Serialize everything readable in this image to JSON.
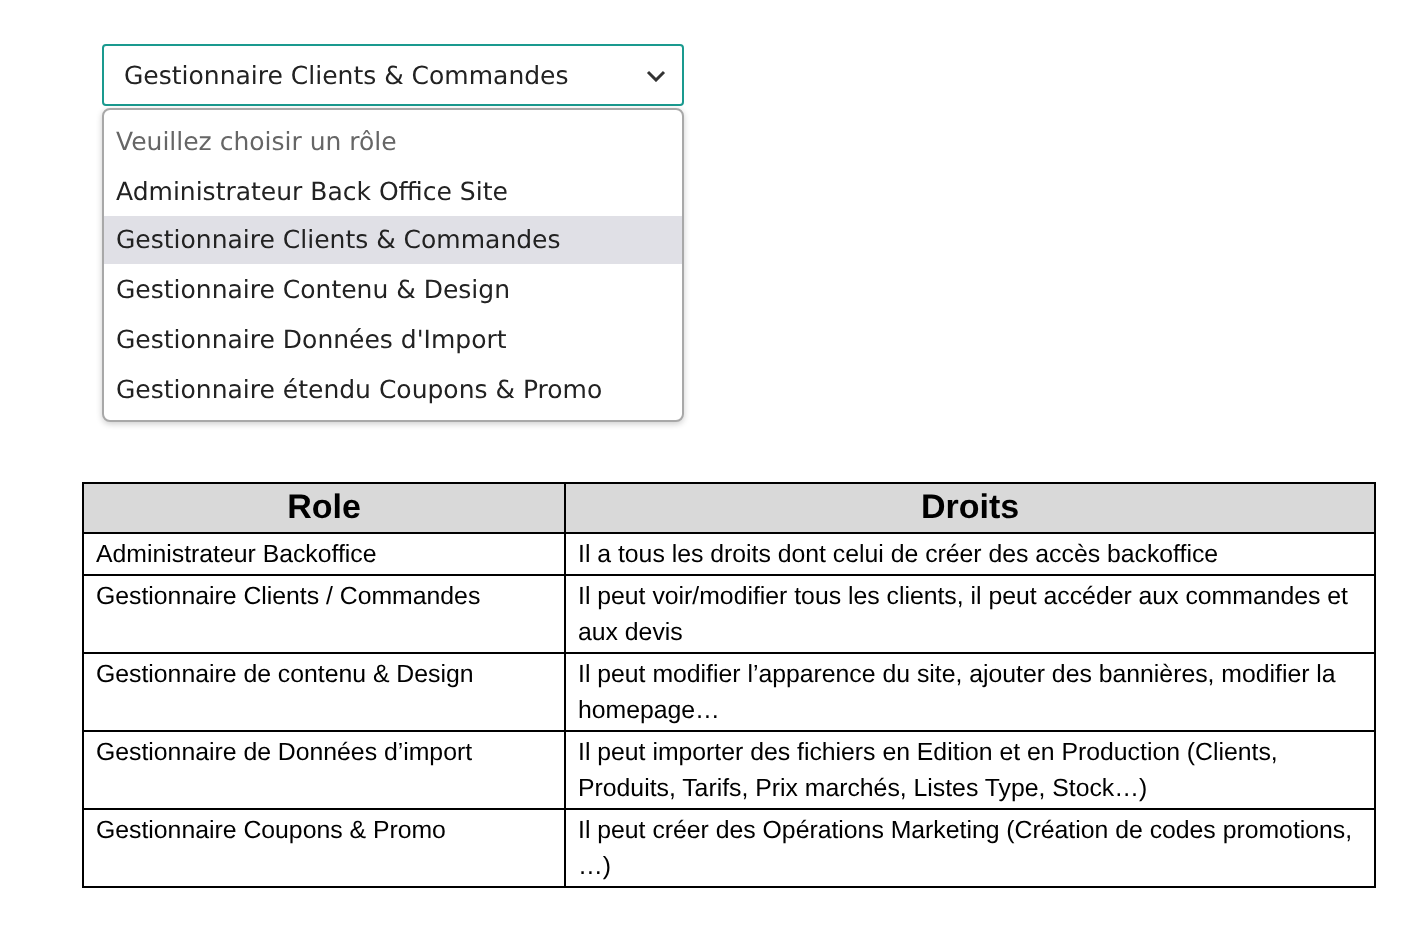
{
  "role_select": {
    "value": "Gestionnaire Clients & Commandes",
    "expanded": true,
    "options": [
      {
        "label": "Veuillez choisir un rôle",
        "kind": "placeholder",
        "selected": false
      },
      {
        "label": "Administrateur Back Office Site",
        "kind": "option",
        "selected": false
      },
      {
        "label": "Gestionnaire Clients & Commandes",
        "kind": "option",
        "selected": true
      },
      {
        "label": "Gestionnaire Contenu & Design",
        "kind": "option",
        "selected": false
      },
      {
        "label": "Gestionnaire Données d'Import",
        "kind": "option",
        "selected": false
      },
      {
        "label": "Gestionnaire étendu Coupons & Promo",
        "kind": "option",
        "selected": false
      }
    ]
  },
  "table": {
    "columns": [
      "Role",
      "Droits"
    ],
    "rows": [
      [
        "Administrateur Backoffice",
        "Il a tous les droits dont celui de créer des accès backoffice"
      ],
      [
        "Gestionnaire Clients / Commandes",
        "Il peut voir/modifier tous les clients, il peut accéder aux commandes et aux devis"
      ],
      [
        "Gestionnaire de contenu & Design",
        "Il peut modifier l’apparence du site, ajouter des bannières, modifier la homepage…"
      ],
      [
        "Gestionnaire de Données d’import",
        "Il peut importer des fichiers en Edition et en Production (Clients, Produits, Tarifs, Prix marchés, Listes Type, Stock…)"
      ],
      [
        "Gestionnaire Coupons & Promo",
        "Il peut créer des Opérations Marketing (Création de codes promotions, …)"
      ]
    ]
  }
}
